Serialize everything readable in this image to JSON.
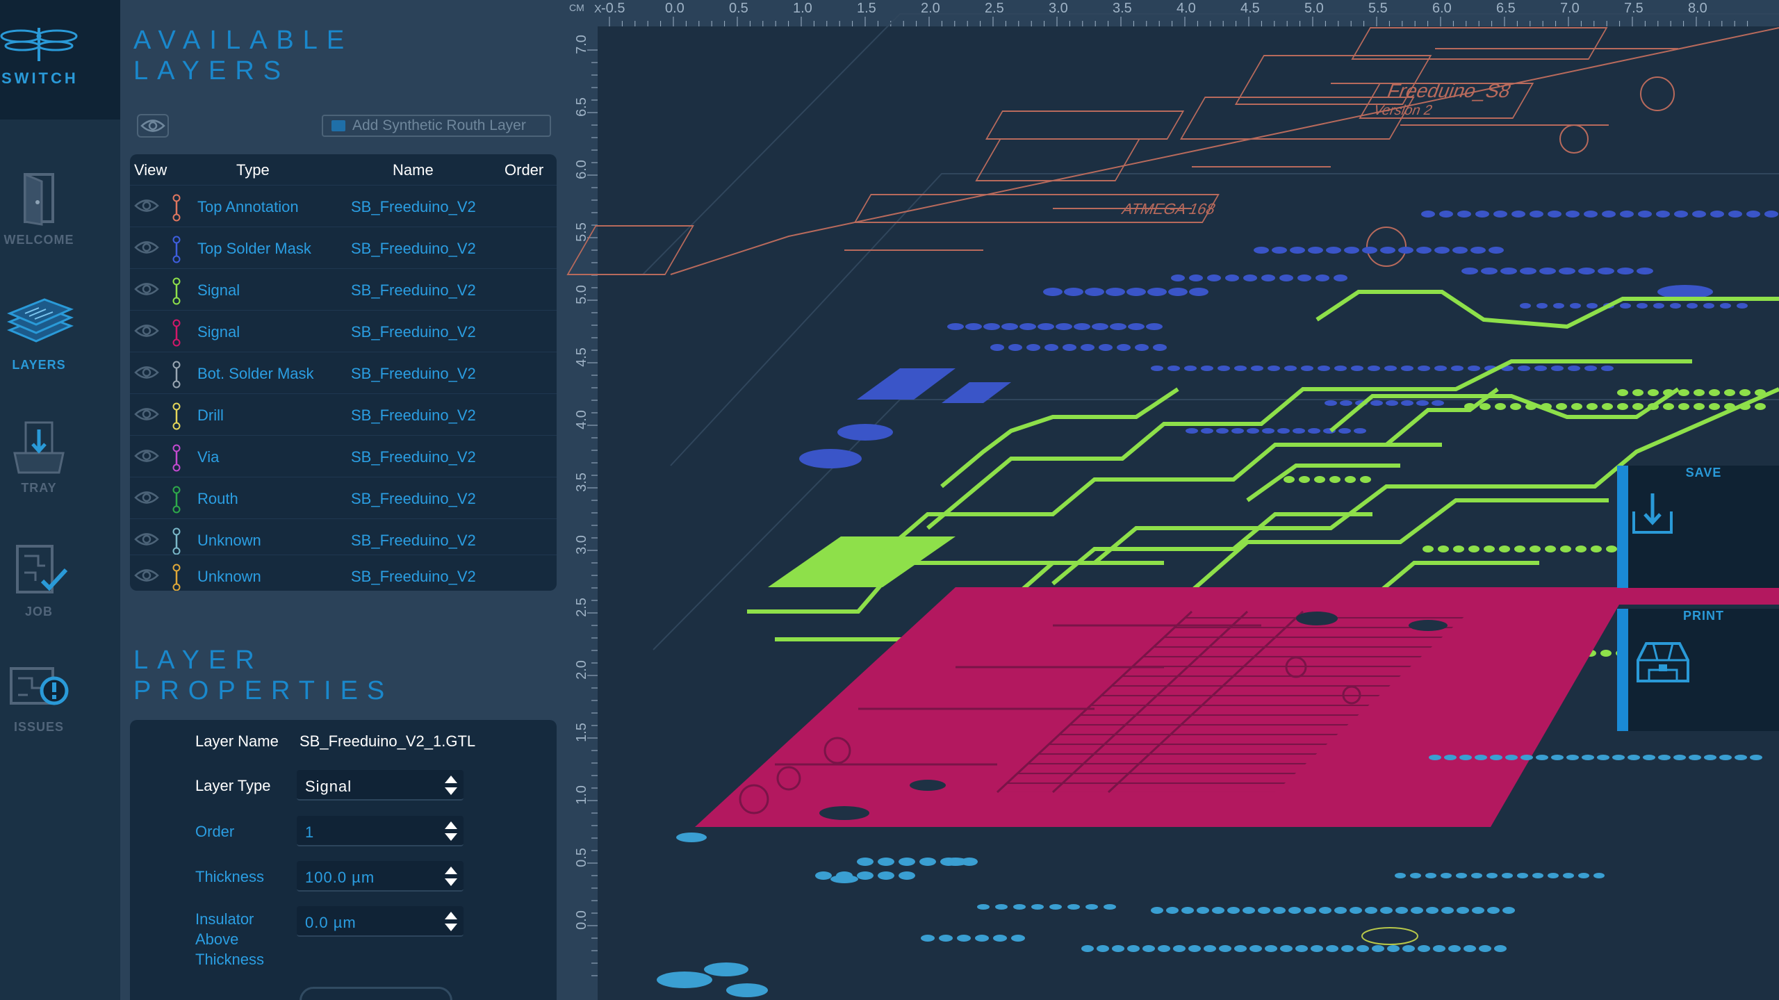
{
  "app": {
    "brand": "SWITCH"
  },
  "nav": [
    {
      "label": "WELCOME",
      "icon": "welcome-door-icon"
    },
    {
      "label": "LAYERS",
      "icon": "layers-stack-icon",
      "active": true
    },
    {
      "label": "TRAY",
      "icon": "tray-download-icon"
    },
    {
      "label": "JOB",
      "icon": "job-board-check-icon"
    },
    {
      "label": "ISSUES",
      "icon": "issues-alert-icon"
    }
  ],
  "available_layers": {
    "title": "AVAILABLE LAYERS",
    "add_button": "Add Synthetic Routh Layer",
    "columns": [
      "View",
      "Type",
      "Name",
      "Order"
    ],
    "rows": [
      {
        "type": "Top Annotation",
        "name": "SB_Freeduino_V2",
        "color": "#e0765f"
      },
      {
        "type": "Top Solder Mask",
        "name": "SB_Freeduino_V2",
        "color": "#3f5fe0"
      },
      {
        "type": "Signal",
        "name": "SB_Freeduino_V2",
        "color": "#8ee04a"
      },
      {
        "type": "Signal",
        "name": "SB_Freeduino_V2",
        "color": "#d2186a"
      },
      {
        "type": "Bot. Solder Mask",
        "name": "SB_Freeduino_V2",
        "color": "#9aa7b3"
      },
      {
        "type": "Drill",
        "name": "SB_Freeduino_V2",
        "color": "#e5d65a"
      },
      {
        "type": "Via",
        "name": "SB_Freeduino_V2",
        "color": "#c44ad0"
      },
      {
        "type": "Routh",
        "name": "SB_Freeduino_V2",
        "color": "#2eaa4a"
      },
      {
        "type": "Unknown",
        "name": "SB_Freeduino_V2",
        "color": "#7ab8c9"
      },
      {
        "type": "Unknown",
        "name": "SB_Freeduino_V2",
        "color": "#e0a838"
      }
    ]
  },
  "layer_properties": {
    "title": "LAYER PROPERTIES",
    "layer_name_label": "Layer Name",
    "layer_name_value": "SB_Freeduino_V2_1.GTL",
    "layer_type_label": "Layer Type",
    "layer_type_value": "Signal",
    "order_label": "Order",
    "order_value": "1",
    "thickness_label": "Thickness",
    "thickness_value": "100.0 µm",
    "insulator_label_1": "Insulator",
    "insulator_label_2": "Above",
    "insulator_label_3": "Thickness",
    "insulator_value": "0.0 µm"
  },
  "viewer": {
    "unit": "CM",
    "x_axis_label": "X",
    "x_ticks": [
      "-0.5",
      "0.0",
      "0.5",
      "1.0",
      "1.5",
      "2.0",
      "2.5",
      "3.0",
      "3.5",
      "4.0",
      "4.5",
      "5.0",
      "5.5",
      "6.0",
      "6.5",
      "7.0",
      "7.5",
      "8.0"
    ],
    "y_ticks": [
      "7.0",
      "6.5",
      "6.0",
      "5.5",
      "5.0",
      "4.5",
      "4.0",
      "3.5",
      "3.0",
      "2.5",
      "2.0",
      "1.5",
      "1.0",
      "0.5",
      "0.0"
    ],
    "silk_text_1": "Freeduino_S8",
    "silk_text_2": "ATMEGA 168",
    "silk_text_3": "Version 2",
    "layer_colors": {
      "annotation": "#b86a5c",
      "mask": "#3a55c8",
      "signal": "#8ee04a",
      "signal_bottom": "#b3185f",
      "drill": "#3aa3d8"
    }
  },
  "actions": {
    "save": "SAVE",
    "print": "PRINT"
  }
}
